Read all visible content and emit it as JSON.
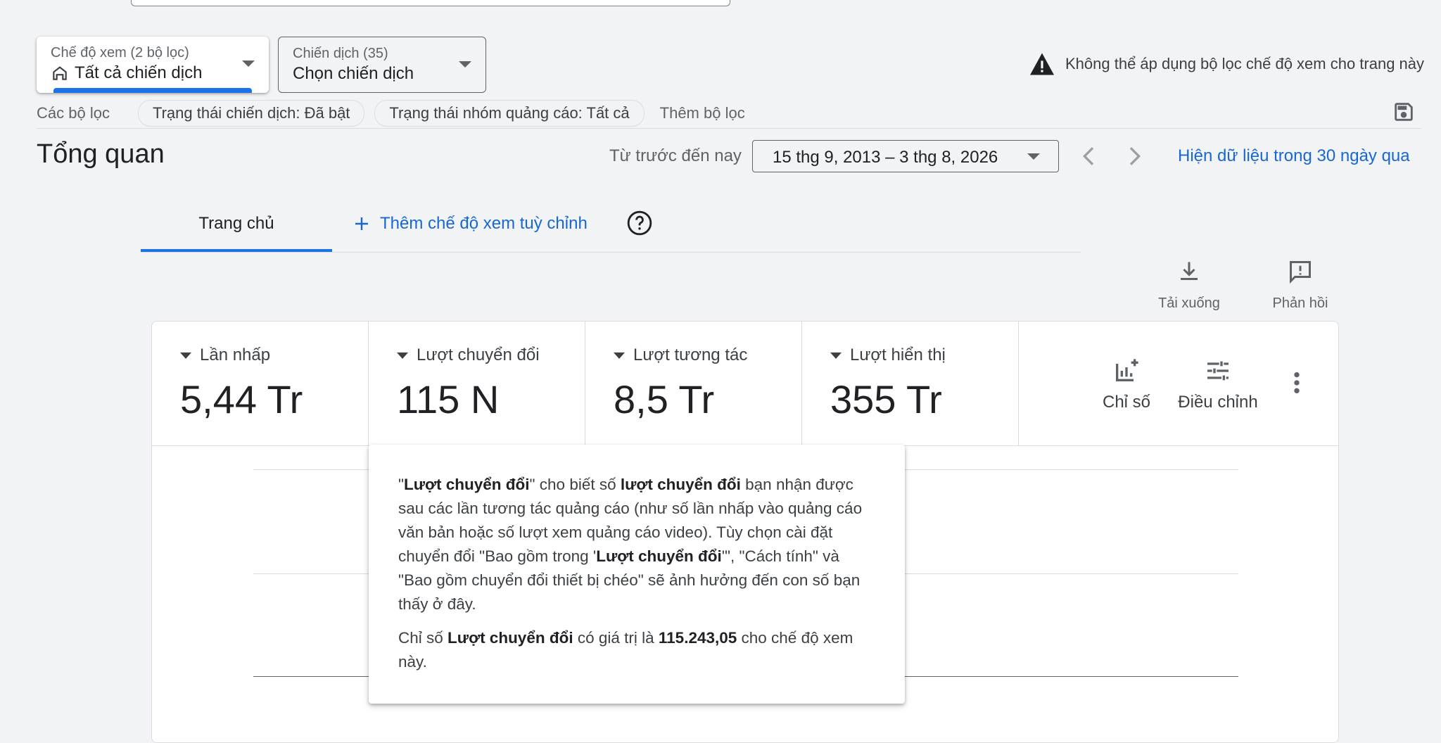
{
  "view_selector": {
    "label": "Chế độ xem (2 bộ lọc)",
    "value": "Tất cả chiến dịch"
  },
  "campaign_selector": {
    "label": "Chiến dịch (35)",
    "value": "Chọn chiến dịch"
  },
  "warning": {
    "text": "Không thể áp dụng bộ lọc chế độ xem cho trang này",
    "icon": "warning-icon"
  },
  "filters": {
    "label": "Các bộ lọc",
    "chips": [
      "Trạng thái chiến dịch: Đã bật",
      "Trạng thái nhóm quảng cáo: Tất cả"
    ],
    "add": "Thêm bộ lọc"
  },
  "page": {
    "title": "Tổng quan",
    "date_label": "Từ trước đến nay",
    "date_range": "15 thg 9, 2013 – 3 thg 8, 2026",
    "show_30": "Hiện dữ liệu trong 30 ngày qua"
  },
  "tabs": {
    "home": "Trang chủ",
    "add_custom": "Thêm chế độ xem tuỳ chỉnh"
  },
  "actions": {
    "download": "Tải xuống",
    "feedback": "Phản hồi"
  },
  "metrics": [
    {
      "name": "Lần nhấp",
      "value": "5,44 Tr"
    },
    {
      "name": "Lượt chuyển đổi",
      "value": "115 N"
    },
    {
      "name": "Lượt tương tác",
      "value": "8,5 Tr"
    },
    {
      "name": "Lượt hiển thị",
      "value": "355 Tr"
    }
  ],
  "card_tools": {
    "metrics": "Chỉ số",
    "adjust": "Điều chỉnh"
  },
  "tooltip": {
    "p1_q1": "\"",
    "p1_b1": "Lượt chuyển đổi",
    "p1_t1": "\" cho biết số ",
    "p1_b2": "lượt chuyển đổi",
    "p1_t2": " bạn nhận được sau các lần tương tác quảng cáo (như số lần nhấp vào quảng cáo văn bản hoặc số lượt xem quảng cáo video). Tùy chọn cài đặt chuyển đổi \"Bao gồm trong '",
    "p1_b3": "Lượt chuyển đổi",
    "p1_t3": "'\", \"Cách tính\" và \"Bao gồm chuyển đổi thiết bị chéo\" sẽ ảnh hưởng đến con số bạn thấy ở đây.",
    "p2_t1": "Chỉ số ",
    "p2_b1": "Lượt chuyển đổi",
    "p2_t2": " có giá trị là ",
    "p2_b2": "115.243,05",
    "p2_t3": " cho chế độ xem này."
  },
  "colors": {
    "accent": "#1a73e8",
    "link": "#1967d2"
  }
}
